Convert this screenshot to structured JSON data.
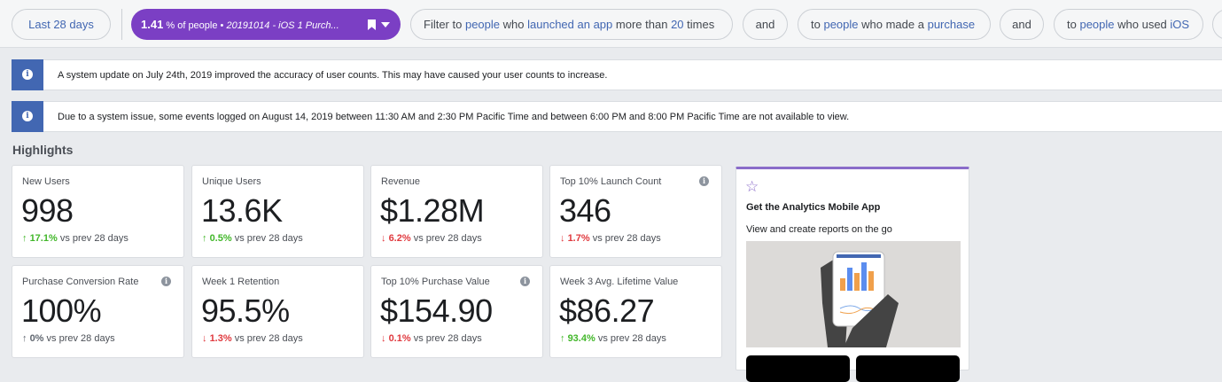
{
  "filters": {
    "date_range": "Last 28 days",
    "segment": {
      "percent": "1.41",
      "suffix": "% of people •",
      "name": "20191014 - iOS 1 Purch..."
    },
    "rule1": {
      "prefix": "Filter to",
      "who": "people",
      "mid": "who",
      "action": "launched an app",
      "cmp": "more than",
      "count": "20",
      "unit": "times"
    },
    "and1": "and",
    "rule2": {
      "prefix": "to",
      "who": "people",
      "mid": "who made a",
      "action": "purchase"
    },
    "and2": "and",
    "rule3": {
      "prefix": "to",
      "who": "people",
      "mid": "who used",
      "value": "iOS"
    }
  },
  "notices": [
    {
      "icon": "info-icon",
      "text": "A system update on July 24th, 2019 improved the accuracy of user counts. This may have caused your user counts to increase."
    },
    {
      "icon": "info-icon",
      "text": "Due to a system issue, some events logged on August 14, 2019 between 11:30 AM and 2:30 PM Pacific Time and between 6:00 PM and 8:00 PM Pacific Time are not available to view."
    }
  ],
  "highlights": {
    "title": "Highlights",
    "cards": [
      {
        "label": "New Users",
        "value": "998",
        "delta": "17.1%",
        "direction": "up",
        "arrow": "↑",
        "compare": "vs prev 28 days"
      },
      {
        "label": "Unique Users",
        "value": "13.6K",
        "delta": "0.5%",
        "direction": "up",
        "arrow": "↑",
        "compare": "vs prev 28 days"
      },
      {
        "label": "Revenue",
        "value": "$1.28M",
        "delta": "6.2%",
        "direction": "down",
        "arrow": "↓",
        "compare": "vs prev 28 days"
      },
      {
        "label": "Top 10% Launch Count",
        "value": "346",
        "delta": "1.7%",
        "direction": "down",
        "arrow": "↓",
        "compare": "vs prev 28 days",
        "info": "i"
      },
      {
        "label": "Purchase Conversion Rate",
        "value": "100%",
        "delta": "0%",
        "direction": "flat",
        "arrow": "↑",
        "compare": "vs prev 28 days",
        "info": "i"
      },
      {
        "label": "Week 1 Retention",
        "value": "95.5%",
        "delta": "1.3%",
        "direction": "down",
        "arrow": "↓",
        "compare": "vs prev 28 days"
      },
      {
        "label": "Top 10% Purchase Value",
        "value": "$154.90",
        "delta": "0.1%",
        "direction": "down",
        "arrow": "↓",
        "compare": "vs prev 28 days",
        "info": "i"
      },
      {
        "label": "Week 3 Avg. Lifetime Value",
        "value": "$86.27",
        "delta": "93.4%",
        "direction": "up",
        "arrow": "↑",
        "compare": "vs prev 28 days"
      }
    ]
  },
  "promo": {
    "icon": "star-icon",
    "title": "Get the Analytics Mobile App",
    "subtitle": "View and create reports on the go"
  },
  "colors": {
    "accent": "#4267b2",
    "segment": "#7b3fc4",
    "up": "#42b72a",
    "down": "#e0393e",
    "promo_border": "#8a6cc9"
  }
}
